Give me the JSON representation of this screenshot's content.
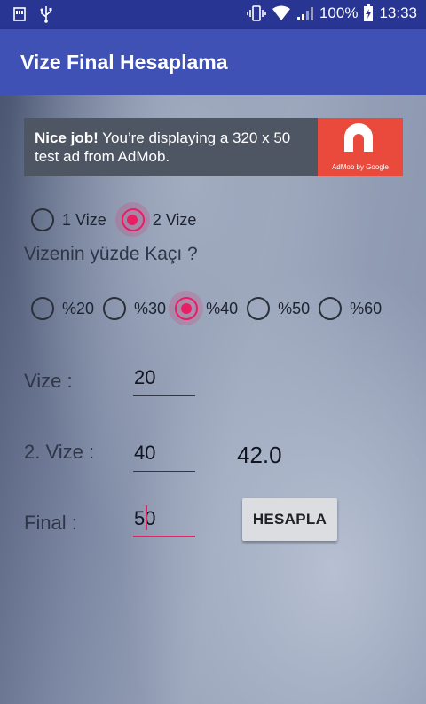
{
  "status_bar": {
    "notifications": [
      "usb-icon",
      "sd-card-icon"
    ],
    "battery_percent": "100%",
    "time": "13:33"
  },
  "app_bar": {
    "title": "Vize Final Hesaplama"
  },
  "ad_banner": {
    "bold_text": "Nice job!",
    "text": " You’re displaying a 320 x 50 test ad from AdMob.",
    "brand": "AdMob by Google"
  },
  "vize_count": {
    "options": [
      "1 Vize",
      "2 Vize"
    ],
    "selected": "2 Vize"
  },
  "percent_question": "Vizenin yüzde Kaçı ?",
  "percent_options": {
    "options": [
      "%20",
      "%30",
      "%40",
      "%50",
      "%60"
    ],
    "selected": "%40"
  },
  "form": {
    "vize1_label": "Vize :",
    "vize1_value": "20",
    "vize2_label": "2. Vize :",
    "vize2_value": "40",
    "final_label": "Final :",
    "final_value": "50",
    "result": "42.0",
    "calculate_label": "HESAPLA"
  },
  "colors": {
    "primary": "#3f51b5",
    "primary_dark": "#283593",
    "accent": "#e91e63"
  }
}
